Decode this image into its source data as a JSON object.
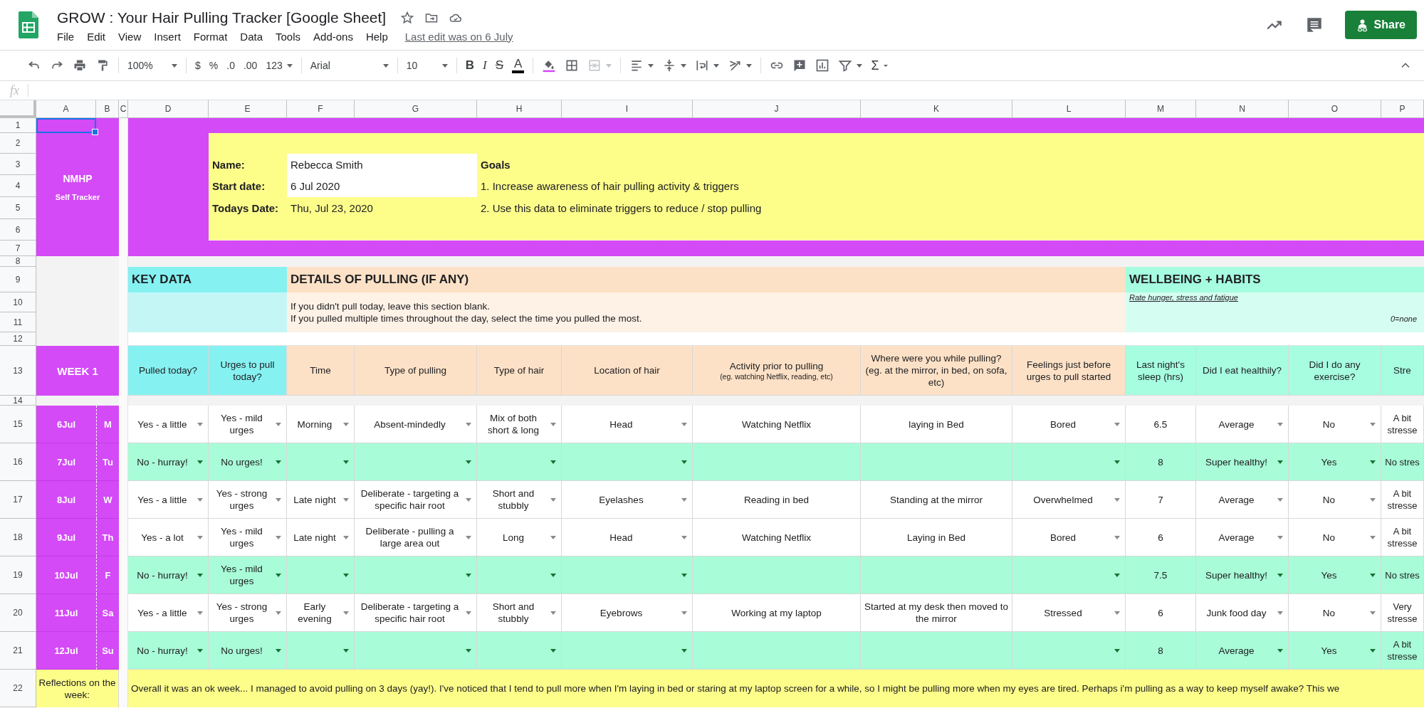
{
  "app": {
    "title": "GROW : Your Hair Pulling Tracker [Google Sheet]",
    "menu": [
      "File",
      "Edit",
      "View",
      "Insert",
      "Format",
      "Data",
      "Tools",
      "Add-ons",
      "Help"
    ],
    "last_edit": "Last edit was on 6 July",
    "share": "Share"
  },
  "toolbar": {
    "zoom": "100%",
    "currency": "$",
    "percent": "%",
    "decrease_decimals": ".0",
    "increase_decimals": ".00",
    "more_formats": "123",
    "font": "Arial",
    "font_size": "10",
    "bold": "B",
    "italic": "I",
    "strikethrough": "S",
    "text_color": "A",
    "functions": "Σ"
  },
  "formula_bar": {
    "label": "fx"
  },
  "column_headers": [
    "A",
    "B",
    "C",
    "D",
    "E",
    "F",
    "G",
    "H",
    "I",
    "J",
    "K",
    "L",
    "M",
    "N",
    "O",
    "P"
  ],
  "row_numbers": [
    "1",
    "2",
    "3",
    "4",
    "5",
    "6",
    "7",
    "8",
    "9",
    "10",
    "11",
    "12",
    "13",
    "14",
    "15",
    "16",
    "17",
    "18",
    "19",
    "20",
    "21",
    "22"
  ],
  "tracker": {
    "brand": "NMHP",
    "subtitle": "Self Tracker",
    "fields": [
      {
        "label": "Name:",
        "value": "Rebecca Smith",
        "editable": true
      },
      {
        "label": "Start date:",
        "value": "6 Jul 2020",
        "editable": true
      },
      {
        "label": "Todays Date:",
        "value": "Thu, Jul 23, 2020",
        "editable": false
      }
    ],
    "goals_title": "Goals",
    "goals": [
      "1. Increase awareness of hair pulling activity & triggers",
      "2. Use this data to eliminate triggers to reduce / stop pulling"
    ]
  },
  "sections": [
    {
      "title": "KEY DATA",
      "color": "#86f1f1",
      "columns": [
        {
          "header": "Pulled today?",
          "kind": "dropdown"
        },
        {
          "header": "Urges to pull today?",
          "kind": "dropdown"
        }
      ]
    },
    {
      "title": "DETAILS OF PULLING (IF ANY)",
      "color": "#fde1c6",
      "notes": [
        {
          "kind": "plain",
          "text": "If you didn't pull today, leave this section blank."
        },
        {
          "kind": "plain",
          "text": "If you pulled multiple times throughout the day, select the time you pulled the most."
        }
      ],
      "columns": [
        {
          "header": "Time",
          "kind": "dropdown"
        },
        {
          "header": "Type of pulling",
          "kind": "dropdown"
        },
        {
          "header": "Type of hair",
          "kind": "dropdown"
        },
        {
          "header": "Location of hair",
          "kind": "dropdown"
        },
        {
          "header": "Activity prior to pulling",
          "note": "(eg. watching Netflix, reading, etc)",
          "kind": "text"
        },
        {
          "header": "Where were you while pulling? (eg. at the mirror, in bed, on sofa, etc)",
          "kind": "text"
        },
        {
          "header": "Feelings just before urges to pull started",
          "kind": "dropdown"
        }
      ]
    },
    {
      "title": "WELLBEING + HABITS",
      "color": "#a6fde0",
      "notes": [
        {
          "kind": "link",
          "text": "Rate hunger, stress and fatigue"
        },
        {
          "kind": "legend",
          "text": "0=none"
        }
      ],
      "columns": [
        {
          "header": "Last night's sleep (hrs)",
          "kind": "text"
        },
        {
          "header": "Did I eat healthily?",
          "kind": "dropdown"
        },
        {
          "header": "Did I do any exercise?",
          "kind": "dropdown"
        },
        {
          "header": "Stre",
          "kind": "text"
        }
      ]
    }
  ],
  "week": {
    "label": "WEEK 1",
    "days": [
      {
        "date": "6Jul",
        "day": "M",
        "pulled": true,
        "cells": [
          "Yes - a little",
          "Yes - mild urges",
          "Morning",
          "Absent-mindedly",
          "Mix of both short & long",
          "Head",
          "Watching Netflix",
          "laying in Bed",
          "Bored",
          "6.5",
          "Average",
          "No",
          "A bit stresse"
        ]
      },
      {
        "date": "7Jul",
        "day": "Tu",
        "pulled": false,
        "cells": [
          "No - hurray!",
          "No urges!",
          null,
          null,
          null,
          null,
          null,
          null,
          null,
          "8",
          "Super healthy!",
          "Yes",
          "No stres"
        ]
      },
      {
        "date": "8Jul",
        "day": "W",
        "pulled": true,
        "cells": [
          "Yes - a little",
          "Yes - strong urges",
          "Late night",
          "Deliberate - targeting a specific hair root",
          "Short and stubbly",
          "Eyelashes",
          "Reading in bed",
          "Standing at the mirror",
          "Overwhelmed",
          "7",
          "Average",
          "No",
          "A bit stresse"
        ]
      },
      {
        "date": "9Jul",
        "day": "Th",
        "pulled": true,
        "cells": [
          "Yes - a lot",
          "Yes - mild urges",
          "Late night",
          "Deliberate - pulling a large area out",
          "Long",
          "Head",
          "Watching Netflix",
          "Laying in Bed",
          "Bored",
          "6",
          "Average",
          "No",
          "A bit stresse"
        ]
      },
      {
        "date": "10Jul",
        "day": "F",
        "pulled": false,
        "cells": [
          "No - hurray!",
          "Yes - mild urges",
          null,
          null,
          null,
          null,
          null,
          null,
          null,
          "7.5",
          "Super healthy!",
          "Yes",
          "No stres"
        ]
      },
      {
        "date": "11Jul",
        "day": "Sa",
        "pulled": true,
        "cells": [
          "Yes - a little",
          "Yes - strong urges",
          "Early evening",
          "Deliberate - targeting a specific hair root",
          "Short and stubbly",
          "Eyebrows",
          "Working at my laptop",
          "Started at my desk then moved to the mirror",
          "Stressed",
          "6",
          "Junk food day",
          "No",
          "Very stresse"
        ]
      },
      {
        "date": "12Jul",
        "day": "Su",
        "pulled": false,
        "cells": [
          "No - hurray!",
          "No urges!",
          null,
          null,
          null,
          null,
          null,
          null,
          null,
          "8",
          "Average",
          "Yes",
          "A bit stresse"
        ]
      }
    ],
    "reflections": {
      "label": "Reflections on the week:",
      "text": "Overall it was an ok week... I managed to avoid pulling on 3 days (yay!). I've noticed that I tend to pull more when I'm laying in bed or staring at my laptop screen for a while, so I might be pulling more when my eyes are tired. Perhaps i'm pulling as a way to keep myself awake? This we"
    }
  }
}
